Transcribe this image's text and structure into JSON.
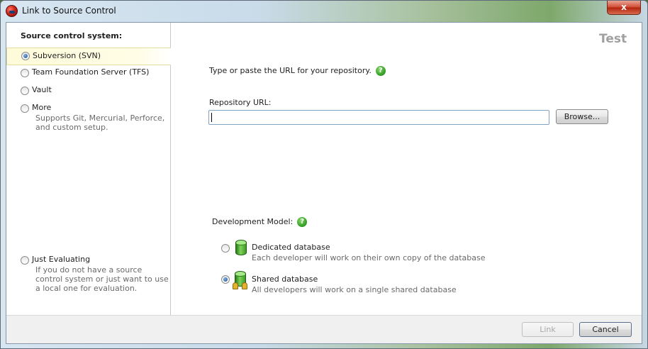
{
  "window": {
    "title": "Link to Source Control",
    "close_label": "x"
  },
  "left_pane": {
    "heading": "Source control system:",
    "options": [
      {
        "label": "Subversion (SVN)",
        "selected": true
      },
      {
        "label": "Team Foundation Server (TFS)",
        "selected": false
      },
      {
        "label": "Vault",
        "selected": false
      },
      {
        "label": "More",
        "description": "Supports Git, Mercurial, Perforce, and custom setup.",
        "selected": false
      }
    ],
    "evaluate": {
      "label": "Just Evaluating",
      "description": "If you do not have a source control system or just want to use a local one for evaluation.",
      "selected": false
    }
  },
  "main": {
    "test_label": "Test",
    "instruction": "Type or paste the URL for your repository.",
    "url_label": "Repository URL:",
    "url_value": "",
    "browse_label": "Browse...",
    "dev_model_label": "Development Model:",
    "models": [
      {
        "title": "Dedicated database",
        "description": "Each developer will work on their own copy of the database",
        "selected": false
      },
      {
        "title": "Shared database",
        "description": "All developers will work on a single shared database",
        "selected": true
      }
    ]
  },
  "footer": {
    "link_label": "Link",
    "cancel_label": "Cancel"
  },
  "colors": {
    "accent": "#2d9a20",
    "selection_bg": "#fdfbd9",
    "close_red": "#cf4a33"
  },
  "icons": {
    "app": "redgate-app-icon",
    "help": "help-icon",
    "database": "database-icon"
  }
}
